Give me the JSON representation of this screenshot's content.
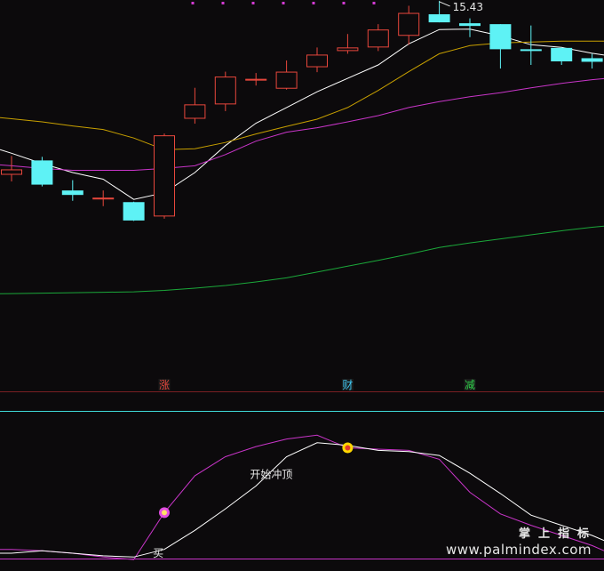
{
  "chart_data": [
    {
      "type": "candlestick",
      "title": "",
      "price_label": "15.43",
      "colors": {
        "up": "#e8473c",
        "down": "#5ef2f5",
        "background": "#0c0a0c"
      },
      "ylim": [
        8.2,
        15.6
      ],
      "candles": [
        {
          "open": 11.9,
          "close": 12.02,
          "high": 12.32,
          "low": 11.75
        },
        {
          "open": 12.22,
          "close": 11.68,
          "high": 12.3,
          "low": 11.64
        },
        {
          "open": 11.55,
          "close": 11.45,
          "high": 11.78,
          "low": 11.32
        },
        {
          "open": 11.35,
          "close": 11.39,
          "high": 11.55,
          "low": 11.2
        },
        {
          "open": 11.29,
          "close": 10.88,
          "high": 11.3,
          "low": 10.87
        },
        {
          "open": 10.97,
          "close": 12.78,
          "high": 12.82,
          "low": 10.92
        },
        {
          "open": 13.15,
          "close": 13.47,
          "high": 13.84,
          "low": 13.04
        },
        {
          "open": 13.47,
          "close": 14.09,
          "high": 14.2,
          "low": 13.32
        },
        {
          "open": 14.0,
          "close": 14.04,
          "high": 14.17,
          "low": 13.89
        },
        {
          "open": 13.82,
          "close": 14.2,
          "high": 14.45,
          "low": 13.8
        },
        {
          "open": 14.3,
          "close": 14.58,
          "high": 14.74,
          "low": 14.19
        },
        {
          "open": 14.66,
          "close": 14.74,
          "high": 15.04,
          "low": 14.6
        },
        {
          "open": 14.74,
          "close": 15.14,
          "high": 15.26,
          "low": 14.66
        },
        {
          "open": 15.0,
          "close": 15.51,
          "high": 15.67,
          "low": 14.8
        },
        {
          "open": 15.48,
          "close": 15.3,
          "high": 15.78,
          "low": 15.3
        },
        {
          "open": 15.28,
          "close": 15.22,
          "high": 15.39,
          "low": 14.97
        },
        {
          "open": 15.26,
          "close": 14.7,
          "high": 15.26,
          "low": 14.27
        },
        {
          "open": 14.7,
          "close": 14.66,
          "high": 15.23,
          "low": 14.35
        },
        {
          "open": 14.73,
          "close": 14.43,
          "high": 14.74,
          "low": 14.35
        },
        {
          "open": 14.5,
          "close": 14.42,
          "high": 14.6,
          "low": 14.27
        }
      ],
      "moving_averages": [
        {
          "color": "#ffffff",
          "values": [
            12.38,
            12.15,
            11.95,
            11.8,
            11.35,
            11.5,
            11.95,
            12.55,
            13.05,
            13.4,
            13.75,
            14.05,
            14.35,
            14.82,
            15.14,
            15.15,
            15.0,
            14.8,
            14.74,
            14.61
          ]
        },
        {
          "color": "#c8a000",
          "values": [
            13.15,
            13.08,
            12.99,
            12.91,
            12.72,
            12.46,
            12.48,
            12.62,
            12.81,
            12.98,
            13.14,
            13.4,
            13.78,
            14.2,
            14.6,
            14.78,
            14.84,
            14.86,
            14.88,
            14.88
          ]
        },
        {
          "color": "#c935c9",
          "values": [
            12.1,
            12.04,
            12.0,
            12.0,
            12.0,
            12.04,
            12.1,
            12.35,
            12.65,
            12.85,
            12.95,
            13.08,
            13.22,
            13.4,
            13.53,
            13.64,
            13.73,
            13.84,
            13.94,
            14.02
          ]
        },
        {
          "color": "#1ba83a",
          "values": [
            9.25,
            9.26,
            9.27,
            9.28,
            9.29,
            9.32,
            9.37,
            9.43,
            9.51,
            9.6,
            9.73,
            9.86,
            9.99,
            10.13,
            10.28,
            10.38,
            10.47,
            10.56,
            10.65,
            10.73
          ]
        }
      ],
      "top_dots": {
        "color": "#d13ad1",
        "count": 7
      }
    },
    {
      "type": "signal_band",
      "markers": [
        {
          "label": "涨",
          "color": "#e0463c",
          "index": 5
        },
        {
          "label": "财",
          "color": "#3fc5f0",
          "index": 11
        },
        {
          "label": "减",
          "color": "#2fd04a",
          "index": 15
        }
      ]
    },
    {
      "type": "line",
      "title": "",
      "annotations": [
        {
          "text": "开始冲顶",
          "x": 8.5,
          "y": 0.64
        },
        {
          "text": "买",
          "x": 4.8,
          "y": 0.02
        }
      ],
      "reference_line_color": "#3fd8d8",
      "ylim": [
        -0.05,
        1.05
      ],
      "series": [
        {
          "color": "#c935c9",
          "values": [
            0.05,
            0.04,
            0.02,
            -0.01,
            -0.03,
            0.34,
            0.63,
            0.78,
            0.86,
            0.92,
            0.95,
            0.85,
            0.84,
            0.83,
            0.76,
            0.5,
            0.33,
            0.24,
            0.16,
            0.08
          ]
        },
        {
          "color": "#ffffff",
          "values": [
            0.02,
            0.04,
            0.02,
            0.0,
            -0.01,
            0.05,
            0.2,
            0.37,
            0.55,
            0.78,
            0.89,
            0.87,
            0.83,
            0.82,
            0.79,
            0.65,
            0.49,
            0.32,
            0.24,
            0.16
          ]
        }
      ],
      "signal_dots": [
        {
          "index": 5,
          "series": 0,
          "fill": "#ffe066",
          "ring": "#e34de3"
        },
        {
          "index": 11,
          "series": 0,
          "fill": "#e03a2a",
          "ring": "#ffd700"
        }
      ]
    }
  ],
  "watermark": {
    "brand": "掌上指标",
    "url": "www.palmindex.com"
  }
}
